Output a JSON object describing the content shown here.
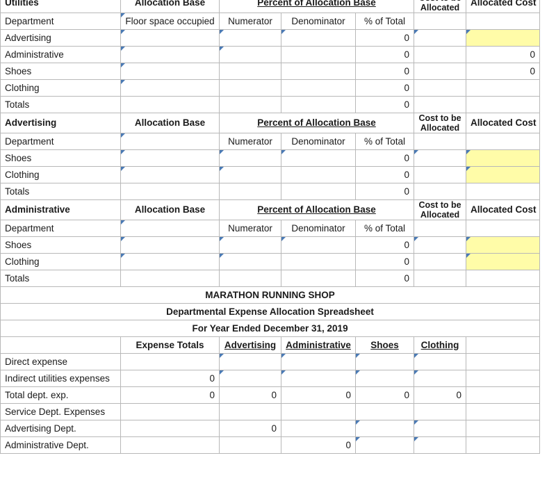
{
  "document": {
    "company": "MARATHON RUNNING SHOP",
    "report_title": "Departmental Expense Allocation Spreadsheet",
    "period": "For Year Ended December 31, 2019"
  },
  "common_headers": {
    "allocation_base": "Allocation Base",
    "percent_of_allocation_base": "Percent of Allocation Base",
    "cost_to_be_allocated": "Cost to be Allocated",
    "allocated_cost": "Allocated Cost",
    "department": "Department",
    "numerator": "Numerator",
    "denominator": "Denominator",
    "percent_of_total": "% of Total",
    "totals": "Totals"
  },
  "colors": {
    "header_blue": "#7CA9DF",
    "input_yellow": "#FFFCA8",
    "input_border_blue": "#5A84B8",
    "grid_line": "#b8b8b8"
  },
  "sections": [
    {
      "name": "utilities",
      "title": "Utilities",
      "base_description": "Floor space occupied",
      "rows": [
        {
          "label": "Advertising",
          "base": "",
          "numerator": "",
          "denominator": "",
          "pct": "0",
          "cost": "",
          "allocated": ""
        },
        {
          "label": "Administrative",
          "base": "",
          "numerator": "",
          "denominator": "",
          "pct": "0",
          "cost": "",
          "allocated": "0"
        },
        {
          "label": "Shoes",
          "base": "",
          "numerator": "",
          "denominator": "",
          "pct": "0",
          "cost": "",
          "allocated": "0"
        },
        {
          "label": "Clothing",
          "base": "",
          "numerator": "",
          "denominator": "",
          "pct": "0",
          "cost": "",
          "allocated": ""
        }
      ],
      "totals": {
        "label": "Totals",
        "base": "",
        "numerator": "",
        "denominator": "",
        "pct": "0",
        "cost": "",
        "allocated": ""
      }
    },
    {
      "name": "advertising",
      "title": "Advertising",
      "base_description": "",
      "rows": [
        {
          "label": "Shoes",
          "base": "",
          "numerator": "",
          "denominator": "",
          "pct": "0",
          "cost": "",
          "allocated": ""
        },
        {
          "label": "Clothing",
          "base": "",
          "numerator": "",
          "denominator": "",
          "pct": "0",
          "cost": "",
          "allocated": ""
        }
      ],
      "totals": {
        "label": "Totals",
        "base": "",
        "numerator": "",
        "denominator": "",
        "pct": "0",
        "cost": "",
        "allocated": ""
      }
    },
    {
      "name": "administrative",
      "title": "Administrative",
      "base_description": "",
      "rows": [
        {
          "label": "Shoes",
          "base": "",
          "numerator": "",
          "denominator": "",
          "pct": "0",
          "cost": "",
          "allocated": ""
        },
        {
          "label": "Clothing",
          "base": "",
          "numerator": "",
          "denominator": "",
          "pct": "0",
          "cost": "",
          "allocated": ""
        }
      ],
      "totals": {
        "label": "Totals",
        "base": "",
        "numerator": "",
        "denominator": "",
        "pct": "0",
        "cost": "",
        "allocated": ""
      }
    }
  ],
  "summary": {
    "columns": [
      "Expense Totals",
      "Advertising",
      "Administrative",
      "Shoes",
      "Clothing"
    ],
    "rows": [
      {
        "label": "Direct expense",
        "expense_totals": "",
        "advertising": "",
        "administrative": "",
        "shoes": "",
        "clothing": ""
      },
      {
        "label": "Indirect utilities expenses",
        "expense_totals": "0",
        "advertising": "",
        "administrative": "",
        "shoes": "",
        "clothing": ""
      },
      {
        "label": "Total dept. exp.",
        "expense_totals": "0",
        "advertising": "0",
        "administrative": "0",
        "shoes": "0",
        "clothing": "0"
      },
      {
        "label": "Service Dept. Expenses",
        "expense_totals": "",
        "advertising": "",
        "administrative": "",
        "shoes": "",
        "clothing": ""
      },
      {
        "label": "Advertising Dept.",
        "expense_totals": "",
        "advertising": "0",
        "administrative": "",
        "shoes": "",
        "clothing": ""
      },
      {
        "label": "Administrative Dept.",
        "expense_totals": "",
        "advertising": "",
        "administrative": "0",
        "shoes": "",
        "clothing": ""
      }
    ]
  }
}
